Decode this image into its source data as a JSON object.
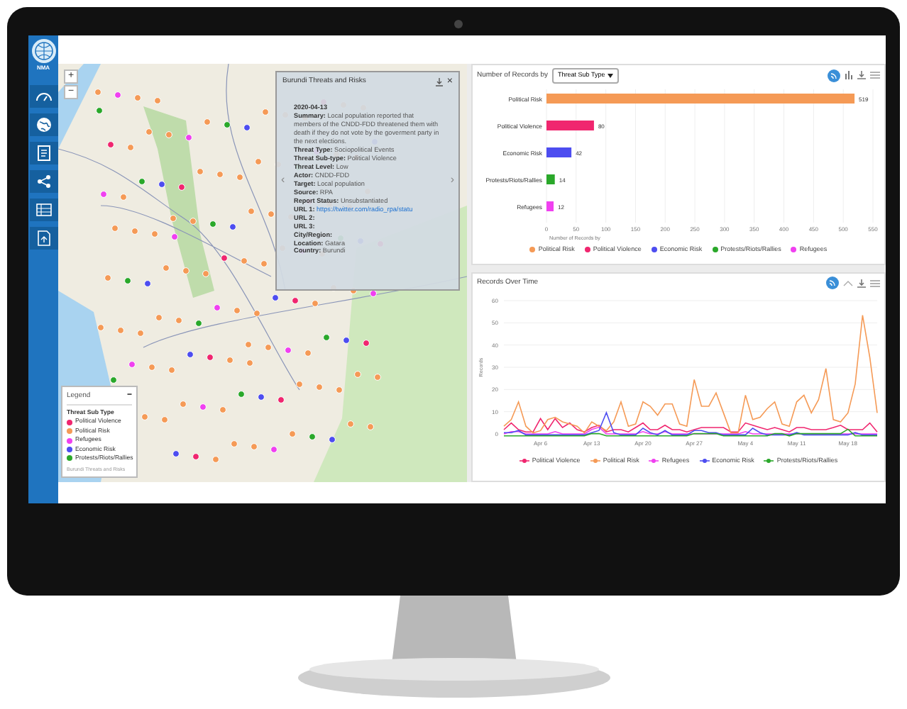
{
  "sidebar": {
    "logo_text": "NMA"
  },
  "map": {
    "zoom_in": "+",
    "zoom_out": "−",
    "popup": {
      "title": "Burundi Threats and Risks",
      "close": "×",
      "prev": "‹",
      "next": "›",
      "date": "2020-04-13",
      "fields": [
        {
          "label": "Summary:",
          "value": "Local population reported that members of the CNDD-FDD threatened them with death if they do not vote by the goverment party in the next elections.",
          "kind": "text"
        },
        {
          "label": "Threat Type:",
          "value": "Sociopolitical Events",
          "kind": "text"
        },
        {
          "label": "Threat Sub-type:",
          "value": "Political Violence",
          "kind": "text"
        },
        {
          "label": "Threat Level:",
          "value": "Low",
          "kind": "text"
        },
        {
          "label": "Actor:",
          "value": "CNDD-FDD",
          "kind": "text"
        },
        {
          "label": "Target:",
          "value": "Local population",
          "kind": "text"
        },
        {
          "label": "Source:",
          "value": "RPA",
          "kind": "text"
        },
        {
          "label": "Report Status:",
          "value": "Unsubstantiated",
          "kind": "text"
        },
        {
          "label": "URL 1:",
          "value": "https://twitter.com/radio_rpa/statu",
          "kind": "link"
        },
        {
          "label": "URL 2:"
        },
        {
          "label": "URL 3:"
        },
        {
          "label": "City/Region:"
        },
        {
          "label": "Location:",
          "value": "Gatara",
          "kind": "text"
        },
        {
          "label": "Country:",
          "value": "Burundi",
          "kind": "text"
        }
      ]
    },
    "legend": {
      "title": "Legend",
      "collapse": "−",
      "heading": "Threat Sub Type",
      "items": [
        {
          "label": "Political Violence",
          "color": "#f0266f"
        },
        {
          "label": "Political Risk",
          "color": "#f59a56"
        },
        {
          "label": "Refugees",
          "color": "#f040f0"
        },
        {
          "label": "Economic Risk",
          "color": "#4d4df0"
        },
        {
          "label": "Protests/Riots/Rallies",
          "color": "#2aa82a"
        }
      ],
      "footer": "Burundi Threats and Risks"
    }
  },
  "bar_panel": {
    "title": "Number of Records by",
    "dropdown": "Threat Sub Type",
    "chart_data": {
      "type": "bar",
      "orientation": "horizontal",
      "stacked": true,
      "xlabel": "Number of Records by",
      "categories": [
        "Political Risk",
        "Political Violence",
        "Economic Risk",
        "Protests/Riots/Rallies",
        "Refugees"
      ],
      "xlim": [
        0,
        550
      ],
      "xticks": [
        0,
        50,
        100,
        150,
        200,
        250,
        300,
        350,
        400,
        450,
        500,
        550
      ],
      "data_labels": true,
      "grid": true,
      "series": [
        {
          "name": "Political Risk",
          "color": "#f59a56",
          "values": [
            519,
            null,
            null,
            null,
            null
          ]
        },
        {
          "name": "Political Violence",
          "color": "#f0266f",
          "values": [
            null,
            80,
            null,
            null,
            null
          ]
        },
        {
          "name": "Economic Risk",
          "color": "#4d4df0",
          "values": [
            null,
            null,
            42,
            null,
            null
          ]
        },
        {
          "name": "Protests/Riots/Rallies",
          "color": "#2aa82a",
          "values": [
            null,
            null,
            null,
            14,
            null
          ]
        },
        {
          "name": "Refugees",
          "color": "#f040f0",
          "values": [
            null,
            null,
            null,
            null,
            12
          ]
        }
      ]
    }
  },
  "line_panel": {
    "title": "Records Over Time",
    "chart_data": {
      "type": "line",
      "ylabel": "Records",
      "ylim": [
        0,
        60
      ],
      "yticks": [
        0,
        10,
        20,
        30,
        40,
        50,
        60
      ],
      "grid": true,
      "categories": [
        null,
        null,
        null,
        null,
        null,
        "Apr 6",
        null,
        null,
        null,
        null,
        null,
        null,
        "Apr 13",
        null,
        null,
        null,
        null,
        null,
        null,
        "Apr 20",
        null,
        null,
        null,
        null,
        null,
        null,
        "Apr 27",
        null,
        null,
        null,
        null,
        null,
        null,
        "May 4",
        null,
        null,
        null,
        null,
        null,
        null,
        "May 11",
        null,
        null,
        null,
        null,
        null,
        null,
        "May 18",
        null,
        null,
        null,
        null
      ],
      "series": [
        {
          "name": "Political Violence",
          "color": "#f0266f",
          "values": [
            1,
            4,
            1,
            0,
            0,
            6,
            1,
            6,
            2,
            4,
            1,
            0,
            2,
            3,
            0,
            1,
            1,
            0,
            2,
            4,
            1,
            1,
            3,
            1,
            1,
            0,
            1,
            2,
            2,
            2,
            2,
            0,
            0,
            4,
            3,
            2,
            1,
            2,
            1,
            0,
            2,
            2,
            1,
            1,
            1,
            2,
            3,
            1,
            1,
            1,
            4,
            0
          ]
        },
        {
          "name": "Political Risk",
          "color": "#f59a56",
          "values": [
            3,
            6,
            14,
            3,
            0,
            1,
            6,
            7,
            5,
            4,
            3,
            0,
            5,
            3,
            1,
            5,
            14,
            3,
            4,
            14,
            12,
            8,
            13,
            13,
            4,
            3,
            24,
            12,
            12,
            18,
            9,
            0,
            0,
            17,
            6,
            7,
            11,
            14,
            4,
            3,
            14,
            17,
            9,
            15,
            29,
            6,
            5,
            9,
            22,
            53,
            34,
            9
          ]
        },
        {
          "name": "Refugees",
          "color": "#f040f0",
          "values": [
            0,
            1,
            1,
            0,
            0,
            0,
            0,
            1,
            0,
            0,
            0,
            0,
            2,
            3,
            0,
            0,
            0,
            0,
            0,
            1,
            0,
            0,
            1,
            0,
            0,
            0,
            0,
            0,
            0,
            0,
            0,
            0,
            0,
            1,
            0,
            0,
            0,
            0,
            0,
            0,
            0,
            0,
            0,
            0,
            0,
            0,
            0,
            0,
            0,
            0,
            0,
            0
          ]
        },
        {
          "name": "Economic Risk",
          "color": "#4d4df0",
          "values": [
            1,
            1,
            2,
            0,
            0,
            0,
            0,
            0,
            0,
            0,
            0,
            0,
            1,
            2,
            10,
            1,
            0,
            0,
            0,
            3,
            1,
            0,
            2,
            0,
            0,
            0,
            2,
            2,
            1,
            1,
            0,
            0,
            0,
            0,
            3,
            1,
            0,
            0,
            0,
            0,
            1,
            0,
            0,
            0,
            0,
            0,
            0,
            0,
            1,
            0,
            0,
            0
          ]
        },
        {
          "name": "Protests/Riots/Rallies",
          "color": "#2aa82a",
          "values": [
            0,
            0,
            0,
            0,
            0,
            0,
            0,
            0,
            0,
            0,
            0,
            0,
            1,
            1,
            0,
            0,
            0,
            0,
            0,
            0,
            0,
            0,
            0,
            0,
            0,
            0,
            1,
            1,
            1,
            1,
            0,
            0,
            0,
            0,
            0,
            0,
            0,
            1,
            1,
            0,
            1,
            1,
            1,
            1,
            1,
            1,
            1,
            3,
            0,
            0,
            0,
            0
          ]
        }
      ]
    }
  }
}
